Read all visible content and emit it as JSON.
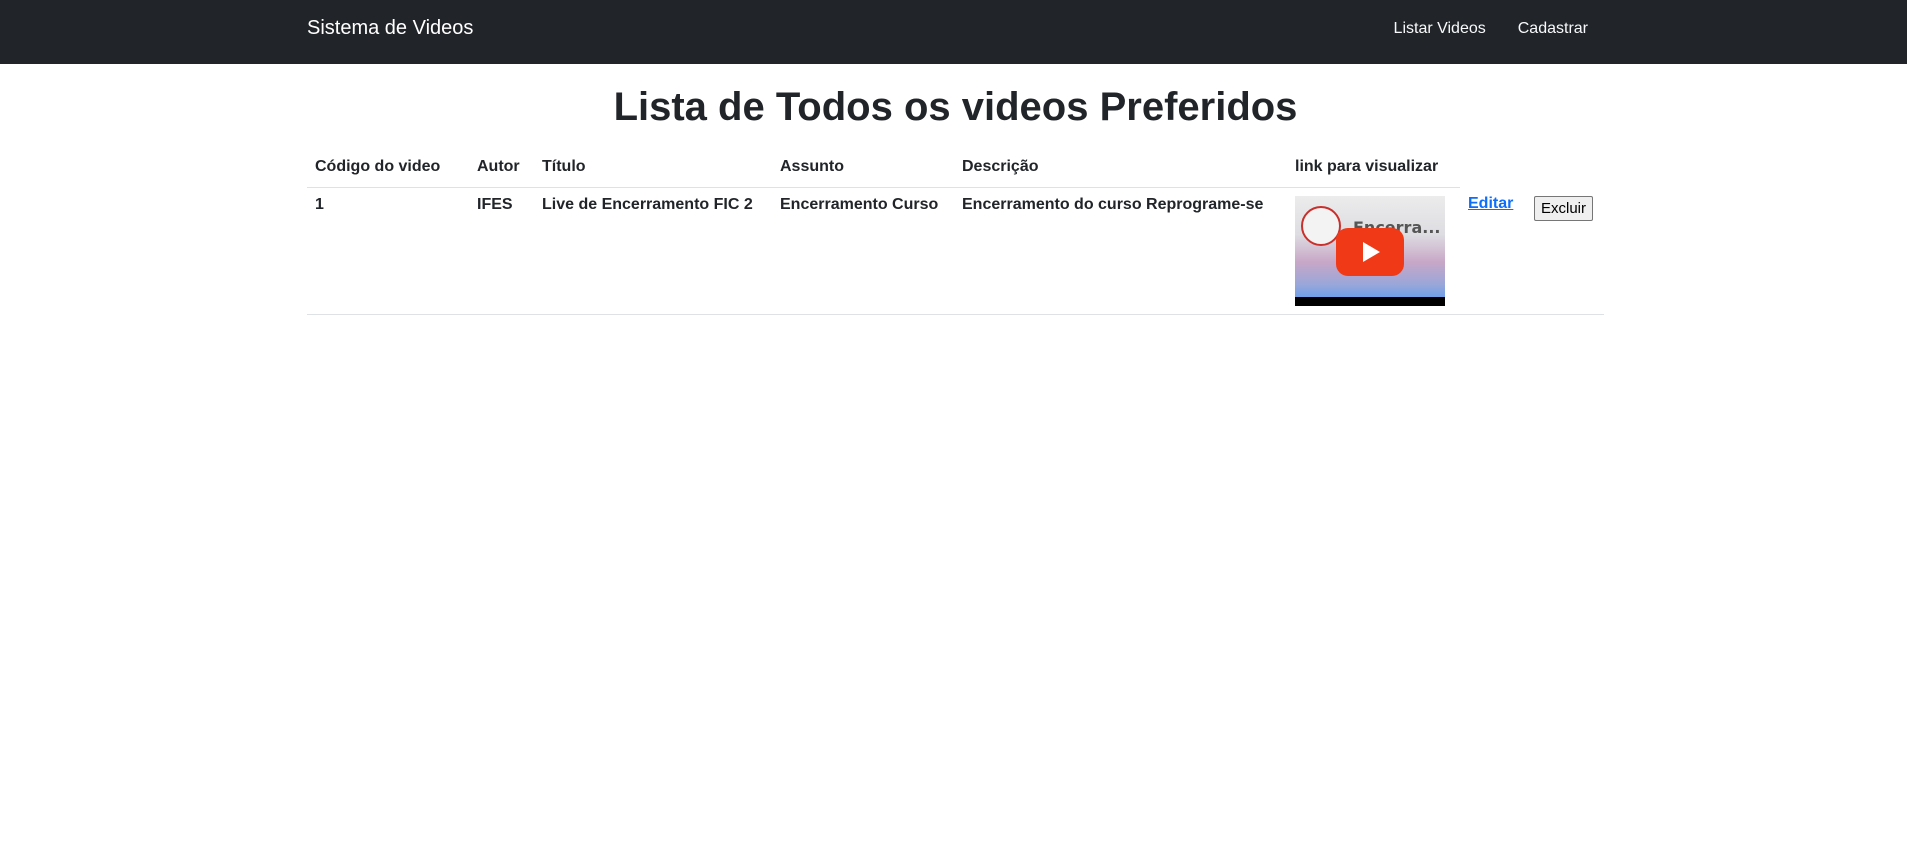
{
  "navbar": {
    "brand": "Sistema de Videos",
    "links": [
      "Listar Videos",
      "Cadastrar"
    ]
  },
  "page": {
    "title": "Lista de Todos os videos Preferidos"
  },
  "table": {
    "headers": [
      "Código do video",
      "Autor",
      "Título",
      "Assunto",
      "Descrição",
      "link para visualizar"
    ],
    "rows": [
      {
        "codigo": "1",
        "autor": "IFES",
        "titulo": "Live de Encerramento FIC 2",
        "assunto": "Encerramento Curso",
        "descricao": "Encerramento do curso Reprograme-se",
        "thumb_title": "Encerra...",
        "edit_label": "Editar",
        "delete_label": "Excluir"
      }
    ]
  },
  "colors": {
    "navbar": "#212529",
    "link": "#0d6efd",
    "play": "#f03a17"
  }
}
